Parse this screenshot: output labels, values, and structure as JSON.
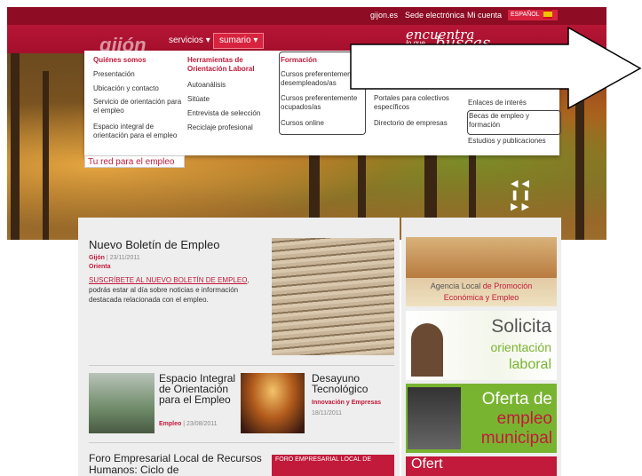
{
  "header": {
    "top_links": [
      "gijon.es",
      "Sede electrónica",
      "Mi cuenta"
    ],
    "language": "ESPAÑOL",
    "logo": "gijón",
    "tagline_line1": "encuentra",
    "tagline_line2": "lo que",
    "tagline_line3": "buscas"
  },
  "nav": {
    "servicios": "servicios",
    "sumario": "sumario"
  },
  "menu": {
    "col1": {
      "heading": "Quiénes somos",
      "items": [
        "Presentación",
        "Ubicación y contacto",
        "Servicio de orientación para el empleo",
        "Espacio integral de orientación para el empleo"
      ]
    },
    "col2": {
      "heading": "Herramientas de Orientación Laboral",
      "items": [
        "Autoanálisis",
        "Sitúate",
        "Entrevista de selección",
        "Reciclaje profesional"
      ]
    },
    "col3": {
      "heading": "Formación",
      "items": [
        "Cursos preferentemente desempleados/as",
        "Cursos preferentemente ocupados/as",
        "Cursos online"
      ]
    },
    "col4": {
      "items": [
        "Portales para colectivos específicos",
        "Directorio de empresas"
      ]
    },
    "col5": {
      "items": [
        "Enlaces de interés",
        "Becas de empleo y formación",
        "Estudios y publicaciones"
      ]
    },
    "footer": "Tu red para el empleo"
  },
  "banner": {
    "controls": "◀◀ ❚❚ ▶▶"
  },
  "news": [
    {
      "title": "Nuevo Boletín de Empleo",
      "place": "Gijón",
      "date": "23/11/2011",
      "category": "Orienta",
      "link_text": "SUSCRÍBETE AL NUEVO BOLETÍN DE EMPLEO",
      "body": ", podrás estar al día sobre noticias e información destacada relacionada con el empleo."
    },
    {
      "title": "Espacio Integral de Orientación para el Empleo",
      "category": "Empleo",
      "date": "23/08/2011"
    },
    {
      "title": "Desayuno Tecnológico",
      "category": "Innovación y Empresas",
      "date": "18/11/2011"
    },
    {
      "title": "Foro Empresarial Local de Recursos Humanos: Ciclo de",
      "image_text": "FORO EMPRESARIAL LOCAL DE"
    }
  ],
  "sidebar": {
    "agencia_line1": "Agencia Local ",
    "agencia_red1": "de Promoción",
    "agencia_red2": "Económica y Empleo",
    "solicita_1": "Solicita",
    "solicita_2": "orientación",
    "solicita_3": "laboral",
    "oferta_1": "Oferta de",
    "oferta_2": "empleo",
    "oferta_3": "municipal",
    "fourth": "Ofert"
  }
}
